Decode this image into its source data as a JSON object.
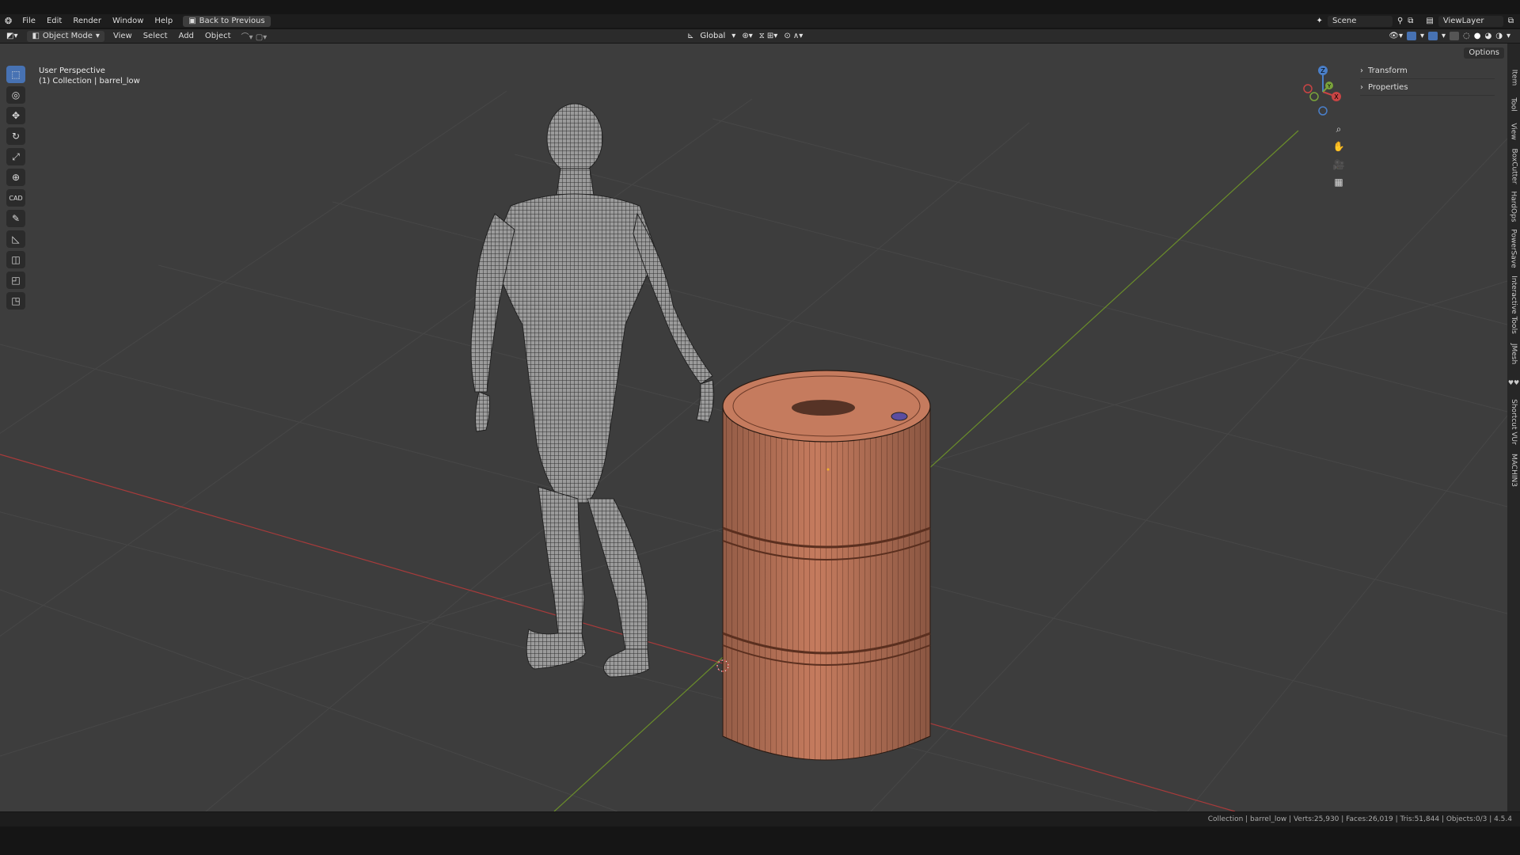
{
  "topbar": {
    "menu": [
      {
        "label": "File"
      },
      {
        "label": "Edit"
      },
      {
        "label": "Render"
      },
      {
        "label": "Window"
      },
      {
        "label": "Help"
      }
    ],
    "back_button": "Back to Previous",
    "scene": "Scene",
    "view_layer": "ViewLayer"
  },
  "header": {
    "mode": "Object Mode",
    "menu": [
      {
        "label": "View"
      },
      {
        "label": "Select"
      },
      {
        "label": "Add"
      },
      {
        "label": "Object"
      }
    ],
    "orientation": "Global"
  },
  "viewport": {
    "perspective": "User Perspective",
    "collection": "(1) Collection | barrel_low",
    "options": "Options"
  },
  "gizmo": {
    "x": "X",
    "y": "Y",
    "z": "Z"
  },
  "npanel": {
    "transform": "Transform",
    "properties": "Properties"
  },
  "tabs": [
    "Item",
    "Tool",
    "View",
    "BoxCutter",
    "HardOps",
    "PowerSave",
    "Interactive Tools",
    "JMesh",
    "Shortcut VUr",
    "MACHIN3"
  ],
  "status": {
    "stats": "Collection | barrel_low | Verts:25,930 | Faces:26,019 | Tris:51,844 | Objects:0/3 | 4.5.4"
  },
  "colors": {
    "barrel": "#c57b5e",
    "x_axis": "#a83b3b",
    "y_axis": "#6a8d2a",
    "accent": "#4772b3"
  },
  "icons": {
    "tools": [
      "select-box-icon",
      "cursor-icon",
      "move-icon",
      "rotate-icon",
      "scale-icon",
      "transform-icon",
      "cad-icon",
      "annotate-icon",
      "measure-icon",
      "add-cube-icon",
      "bevel-icon",
      "sculpt-icon"
    ],
    "nav": [
      "zoom-icon",
      "pan-hand-icon",
      "camera-icon",
      "grid-icon"
    ]
  }
}
